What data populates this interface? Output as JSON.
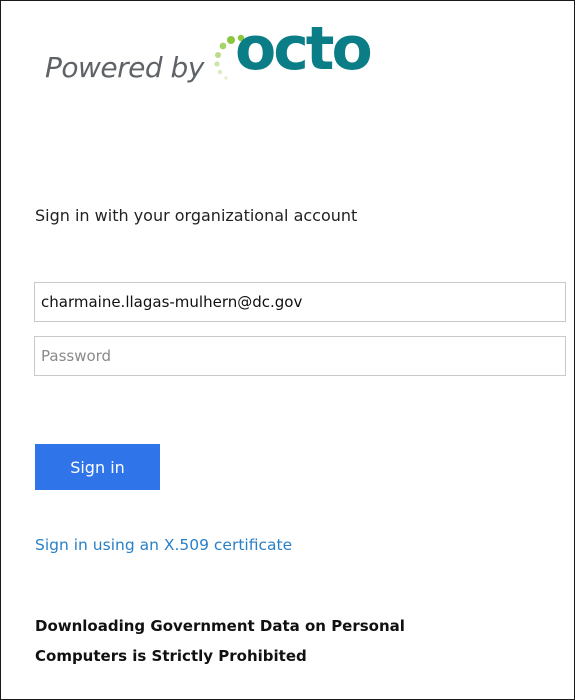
{
  "branding": {
    "powered_by": "Powered by",
    "logo_word": "octo",
    "logo_color": "#0a7d86",
    "dot_color": "#8cc63e"
  },
  "form": {
    "heading": "Sign in with your organizational account",
    "email_value": "charmaine.llagas-mulhern@dc.gov",
    "password_placeholder": "Password",
    "submit_label": "Sign in",
    "submit_color": "#2f74e8"
  },
  "links": {
    "certificate": "Sign in using an X.509 certificate",
    "link_color": "#2a7fc7"
  },
  "notice": {
    "warning_line1": "Downloading Government Data on Personal",
    "warning_line2": "Computers is Strictly Prohibited"
  }
}
